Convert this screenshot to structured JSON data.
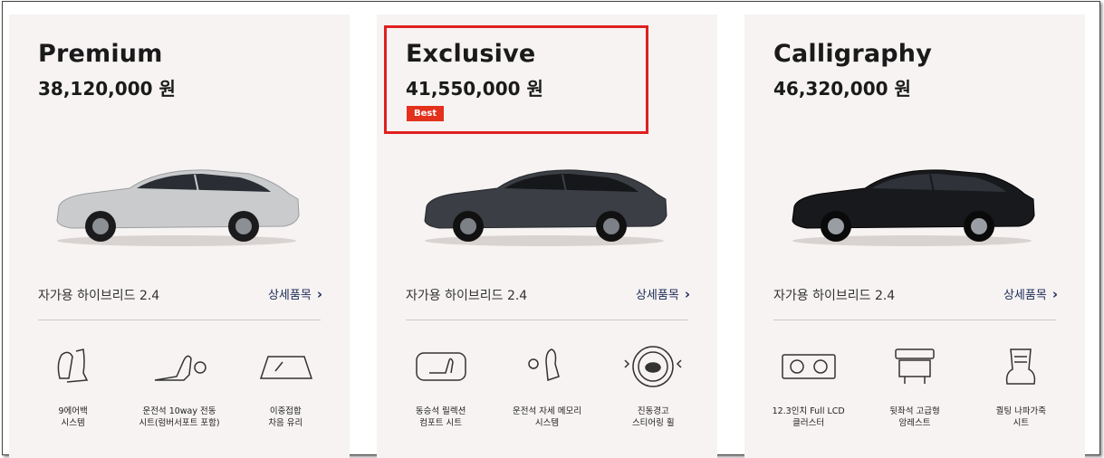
{
  "cards": [
    {
      "name": "Premium",
      "price": "38,120,000 원",
      "trim": "자가용 하이브리드 2.4",
      "detail_label": "상세품목",
      "car_color": "#c9cbcd",
      "features": [
        {
          "icon": "airbag-seat-icon",
          "label": "9에어백\n시스템"
        },
        {
          "icon": "power-seat-icon",
          "label": "운전석 10way 전동\n시트(럼버서포트 포함)"
        },
        {
          "icon": "windshield-icon",
          "label": "이중접합\n차음 유리"
        }
      ]
    },
    {
      "name": "Exclusive",
      "price": "41,550,000 원",
      "badge": "Best",
      "trim": "자가용 하이브리드 2.4",
      "detail_label": "상세품목",
      "car_color": "#3b3e44",
      "features": [
        {
          "icon": "relaxation-seat-icon",
          "label": "동승석 릴렉션\n컴포트 시트"
        },
        {
          "icon": "memory-seat-icon",
          "label": "운전석 자세 메모리\n시스템"
        },
        {
          "icon": "steering-wheel-icon",
          "label": "진동경고\n스티어링 휠"
        }
      ]
    },
    {
      "name": "Calligraphy",
      "price": "46,320,000 원",
      "trim": "자가용 하이브리드 2.4",
      "detail_label": "상세품목",
      "car_color": "#17191d",
      "features": [
        {
          "icon": "lcd-cluster-icon",
          "label": "12.3인치 Full LCD\n클러스터"
        },
        {
          "icon": "rear-armrest-icon",
          "label": "뒷좌석 고급형\n암레스트"
        },
        {
          "icon": "nappa-seat-icon",
          "label": "퀼팅 나파가죽\n시트"
        }
      ]
    }
  ],
  "colors": {
    "badge": "#e3311b",
    "highlight": "#e02020",
    "card_bg": "#f6f3f2"
  }
}
